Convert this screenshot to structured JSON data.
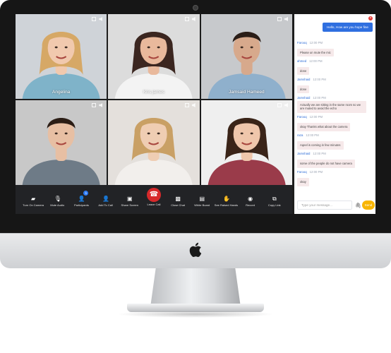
{
  "participants": [
    {
      "name": "Angelina",
      "bg": "#cfd3d8",
      "skin": "#f1c9ae",
      "hair": "#d6a866",
      "shirt": "#7fb3c9"
    },
    {
      "name": "Kris james",
      "bg": "#dcdcdc",
      "skin": "#e9b99c",
      "hair": "#3b2620",
      "shirt": "#f3f3f3"
    },
    {
      "name": "Jamsaid Hameed",
      "bg": "#c7c9cc",
      "skin": "#d7a98c",
      "hair": "#2a1d17",
      "shirt": "#8fb0cc"
    },
    {
      "name": "",
      "bg": "#c8c8c8",
      "skin": "#e7bfa3",
      "hair": "#2b1d15",
      "shirt": "#6e7b87"
    },
    {
      "name": "",
      "bg": "#e4e0dc",
      "skin": "#efcdb3",
      "hair": "#c9a065",
      "shirt": "#f2efec"
    },
    {
      "name": "",
      "bg": "#efefef",
      "skin": "#efc6ab",
      "hair": "#3a2418",
      "shirt": "#9a3b4a"
    }
  ],
  "toolbar": [
    {
      "label": "Turn On Camera",
      "icon": "camera-off-icon",
      "glyph": "▰"
    },
    {
      "label": "Mute Audio",
      "icon": "microphone-icon",
      "glyph": "🎙"
    },
    {
      "label": "Participants",
      "icon": "participants-icon",
      "glyph": "👤",
      "badge": "1"
    },
    {
      "label": "Add To Call",
      "icon": "add-user-icon",
      "glyph": "👤"
    },
    {
      "label": "Share Screen",
      "icon": "share-screen-icon",
      "glyph": "▣"
    },
    {
      "label": "Leave Call",
      "icon": "phone-hangup-icon",
      "glyph": "☎"
    },
    {
      "label": "Close Chat",
      "icon": "chat-off-icon",
      "glyph": "▩"
    },
    {
      "label": "White Board",
      "icon": "whiteboard-icon",
      "glyph": "▤"
    },
    {
      "label": "See Raised Hands",
      "icon": "hand-icon",
      "glyph": "✋"
    },
    {
      "label": "Record",
      "icon": "record-icon",
      "glyph": "◉"
    },
    {
      "label": "Copy Link",
      "icon": "copy-icon",
      "glyph": "⧉"
    }
  ],
  "chat": {
    "outgoing": "Hello, How are you hope fine",
    "messages": [
      {
        "author": "Farooq",
        "time": "12:00 PM",
        "text": "Please un mute the mic"
      },
      {
        "author": "ahmed",
        "time": "12:00 PM",
        "text": "done"
      },
      {
        "author": "Jamshaid",
        "time": "12:00 PM",
        "text": "done"
      },
      {
        "author": "Jamshaid",
        "time": "12:00 PM",
        "text": "Actually we are sitting in the same room so we are muted to avoid the echo"
      },
      {
        "author": "Farooq",
        "time": "12:00 PM",
        "text": "okay Thanks what about the camera"
      },
      {
        "author": "raza",
        "time": "12:00 PM",
        "text": "Aqeel is coming in few minutes"
      },
      {
        "author": "Jamshaid",
        "time": "12:00 PM",
        "text": "some of the people do not have camera"
      },
      {
        "author": "Farooq",
        "time": "12:00 PM",
        "text": "okay"
      }
    ],
    "placeholder": "Type your message...",
    "send_label": "Send"
  },
  "colors": {
    "accent": "#2f6fe0",
    "leave": "#d7292b",
    "send": "#f8b500"
  }
}
